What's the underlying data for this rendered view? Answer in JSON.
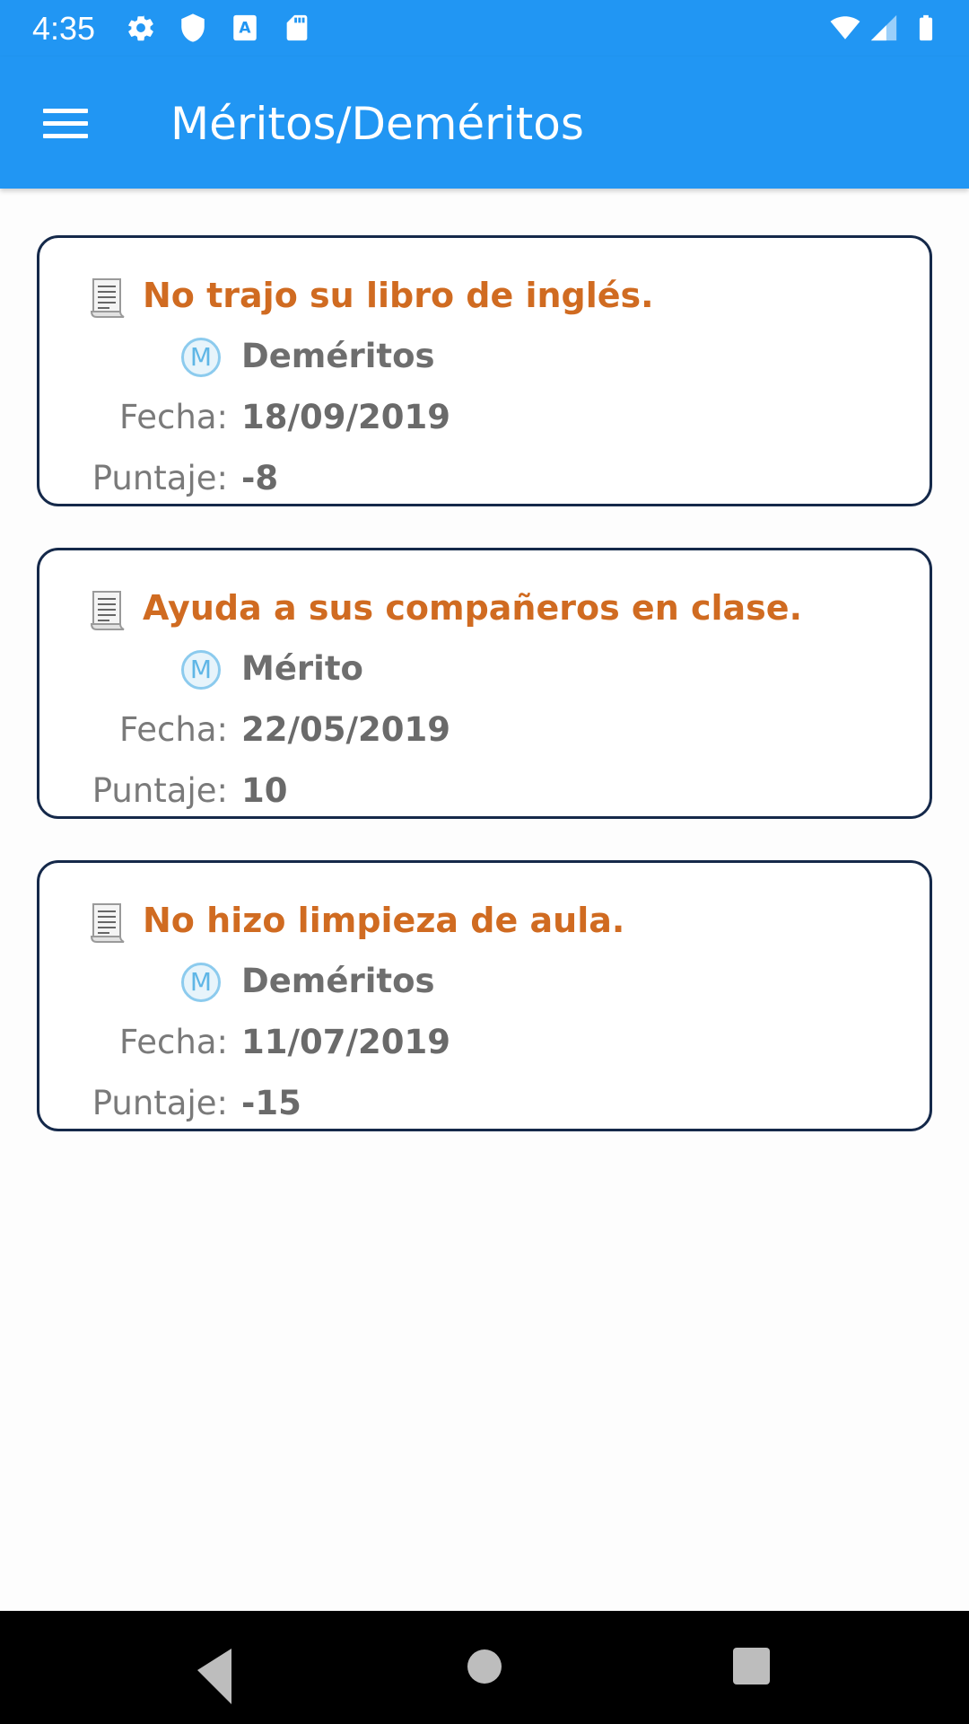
{
  "status_bar": {
    "time": "4:35",
    "left_icons": [
      "settings-icon",
      "shield-icon",
      "keyboard-icon",
      "sd-card-icon"
    ],
    "right_icons": [
      "wifi-icon",
      "cell-signal-icon",
      "battery-icon"
    ]
  },
  "app_bar": {
    "title": "Méritos/Deméritos",
    "menu_icon": "hamburger-menu-icon",
    "background": "#2196f3"
  },
  "colors": {
    "title_text": "#d06b21",
    "card_border": "#15294a",
    "badge": "#5fb6e6"
  },
  "field_labels": {
    "date": "Fecha:",
    "score": "Puntaje:"
  },
  "records": [
    {
      "title": "No trajo su libro de inglés.",
      "badge_letter": "M",
      "type": "Deméritos",
      "date": "18/09/2019",
      "score": "-8"
    },
    {
      "title": "Ayuda a sus compañeros en clase.",
      "badge_letter": "M",
      "type": "Mérito",
      "date": "22/05/2019",
      "score": "10"
    },
    {
      "title": "No hizo limpieza de aula.",
      "badge_letter": "M",
      "type": "Deméritos",
      "date": "11/07/2019",
      "score": "-15"
    }
  ],
  "nav_bar": {
    "buttons": [
      "back-icon",
      "home-icon",
      "recents-icon"
    ]
  }
}
